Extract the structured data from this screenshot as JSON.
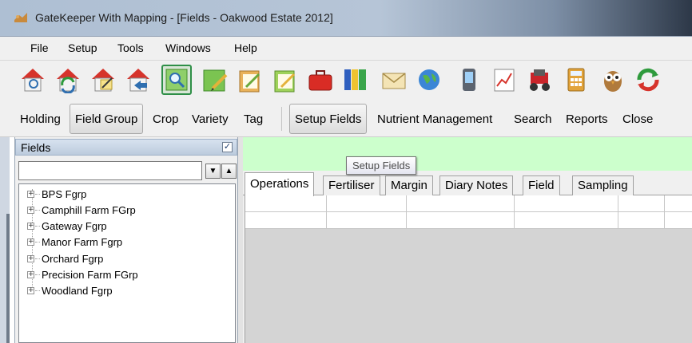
{
  "window": {
    "title": "GateKeeper With Mapping - [Fields - Oakwood Estate 2012]",
    "app_icon": "gatekeeper-app-icon"
  },
  "menu": [
    "File",
    "Setup",
    "Tools",
    "Windows",
    "Help"
  ],
  "icon_toolbar": [
    "holding-icon",
    "holding-refresh-icon",
    "holding-edit-icon",
    "holding-back-icon",
    "field-group-search-icon",
    "crop-pencil-icon",
    "variety-notepad-icon",
    "tag-notepad-icon",
    "briefcase-icon",
    "ledger-icon",
    "mail-icon",
    "globe-icon",
    "handheld-device-icon",
    "chart-icon",
    "tractor-icon",
    "calculator-icon",
    "owl-icon",
    "sync-icon"
  ],
  "text_toolbar": {
    "holding": "Holding",
    "field_group": "Field Group",
    "crop": "Crop",
    "variety": "Variety",
    "tag": "Tag",
    "setup_fields": "Setup Fields",
    "nutrient_management": "Nutrient Management",
    "search": "Search",
    "reports": "Reports",
    "close": "Close"
  },
  "fields_panel": {
    "title": "Fields",
    "checked": true,
    "filter_value": "",
    "tree": [
      "BPS Fgrp",
      "Camphill Farm FGrp",
      "Gateway Fgrp",
      "Manor Farm Fgrp",
      "Orchard Fgrp",
      "Precision Farm FGrp",
      "Woodland Fgrp"
    ]
  },
  "tooltip": "Setup Fields",
  "tabs": [
    "Operations",
    "Fertiliser",
    "Margin",
    "Diary Notes",
    "Field",
    "Sampling"
  ],
  "active_tab": "Operations",
  "colors": {
    "banner": "#ccffcc",
    "active_icon_border": "#2f8f48"
  }
}
